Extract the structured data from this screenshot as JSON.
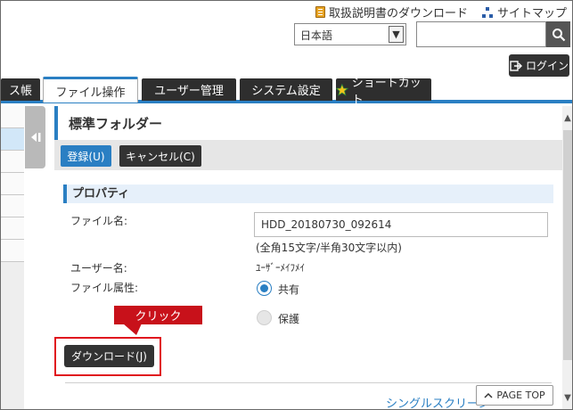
{
  "top_links": {
    "manual_download": "取扱説明書のダウンロード",
    "sitemap": "サイトマップ"
  },
  "language": {
    "selected": "日本語"
  },
  "search": {
    "placeholder": ""
  },
  "login": {
    "label": "ログイン"
  },
  "tabs": [
    {
      "label": "ス帳"
    },
    {
      "label": "ファイル操作",
      "active": true
    },
    {
      "label": "ユーザー管理"
    },
    {
      "label": "システム設定"
    },
    {
      "label": "ショートカット"
    }
  ],
  "folder": {
    "title": "標準フォルダー"
  },
  "buttons": {
    "register": "登録(U)",
    "cancel": "キャンセル(C)",
    "download": "ダウンロード(J)"
  },
  "properties": {
    "heading": "プロパティ",
    "file_name_label": "ファイル名:",
    "file_name_value": "HDD_20180730_092614",
    "file_name_hint": "(全角15文字/半角30文字以内)",
    "user_name_label": "ユーザー名:",
    "user_name_value": "ﾕｰｻﾞｰﾒｲﾌﾒｲ",
    "attribute_label": "ファイル属性:",
    "option_shared": "共有",
    "option_protected": "保護"
  },
  "annotation": {
    "callout": "クリック"
  },
  "footer": {
    "single_screen": "シングルスクリーン",
    "page_top": "PAGE TOP"
  },
  "colors": {
    "accent": "#2a7fc3",
    "tab_dark": "#2e2e2e",
    "callout_red": "#c8111a"
  }
}
